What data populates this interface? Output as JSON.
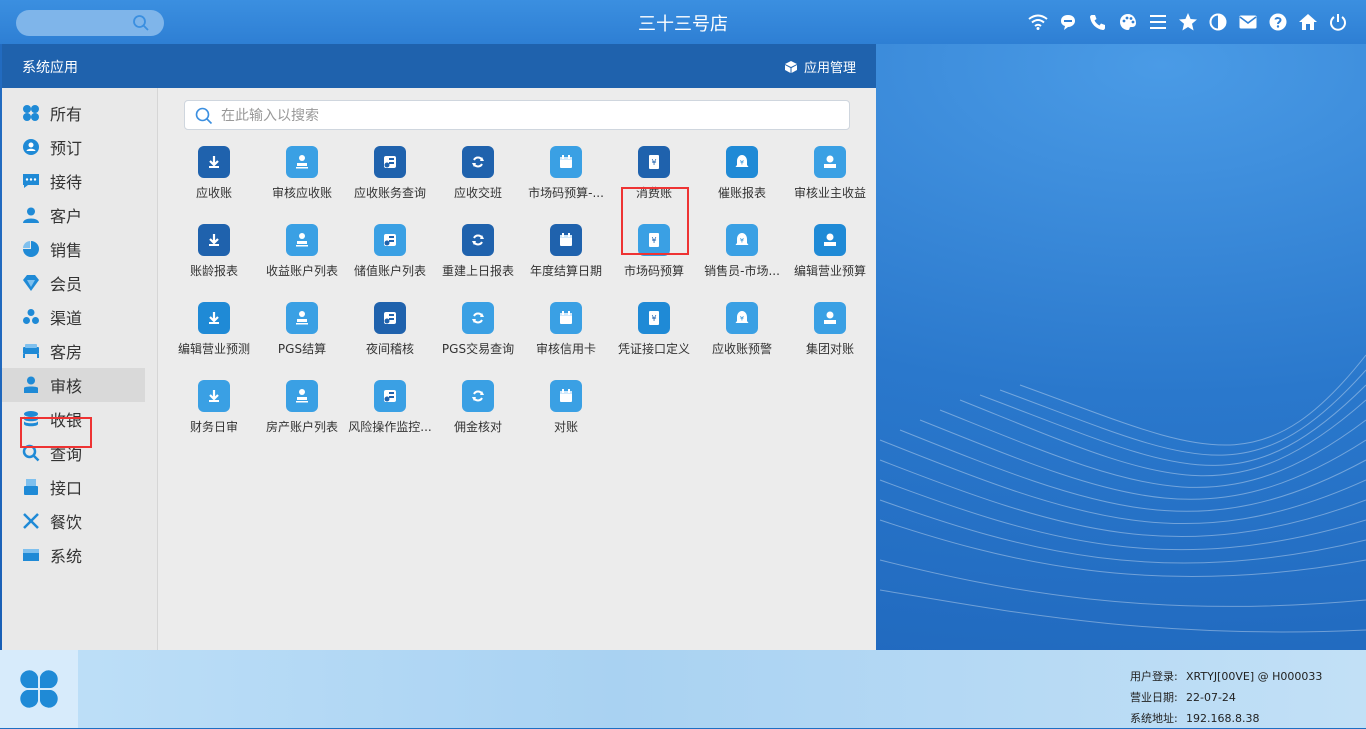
{
  "topbar": {
    "search_placeholder": "",
    "title": "三十三号店",
    "icons": [
      "wifi-icon",
      "chat-icon",
      "phone-icon",
      "palette-icon",
      "menu-icon",
      "star-icon",
      "contrast-icon",
      "mail-icon",
      "help-icon",
      "home-icon",
      "power-icon"
    ]
  },
  "window": {
    "title": "系统应用",
    "app_manage_label": "应用管理",
    "search_placeholder": "在此输入以搜索"
  },
  "sidebar": {
    "items": [
      {
        "label": "所有",
        "icon": "grid-icon"
      },
      {
        "label": "预订",
        "icon": "booking-icon"
      },
      {
        "label": "接待",
        "icon": "reception-icon"
      },
      {
        "label": "客户",
        "icon": "customer-icon"
      },
      {
        "label": "销售",
        "icon": "sales-icon"
      },
      {
        "label": "会员",
        "icon": "member-icon"
      },
      {
        "label": "渠道",
        "icon": "channel-icon"
      },
      {
        "label": "客房",
        "icon": "room-icon"
      },
      {
        "label": "审核",
        "icon": "audit-icon"
      },
      {
        "label": "收银",
        "icon": "cashier-icon"
      },
      {
        "label": "查询",
        "icon": "query-icon"
      },
      {
        "label": "接口",
        "icon": "interface-icon"
      },
      {
        "label": "餐饮",
        "icon": "dining-icon"
      },
      {
        "label": "系统",
        "icon": "system-icon"
      }
    ],
    "active_index": 8
  },
  "apps": [
    {
      "label": "应收账",
      "icon": "receivable-icon",
      "color": "#1f62ad"
    },
    {
      "label": "审核应收账",
      "icon": "audit-receivable-icon",
      "color": "#3aa0e4"
    },
    {
      "label": "应收账务查询",
      "icon": "receivable-query-icon",
      "color": "#1f62ad"
    },
    {
      "label": "应收交班",
      "icon": "shift-handover-icon",
      "color": "#1f62ad"
    },
    {
      "label": "市场码预算-...",
      "icon": "calendar-icon",
      "color": "#3aa0e4"
    },
    {
      "label": "消费账",
      "icon": "consumption-icon",
      "color": "#1f62ad"
    },
    {
      "label": "催账报表",
      "icon": "dunning-icon",
      "color": "#1f8ad6"
    },
    {
      "label": "审核业主收益",
      "icon": "owner-income-icon",
      "color": "#3aa0e4"
    },
    {
      "label": "账龄报表",
      "icon": "aging-report-icon",
      "color": "#1f62ad"
    },
    {
      "label": "收益账户列表",
      "icon": "income-account-icon",
      "color": "#3aa0e4"
    },
    {
      "label": "储值账户列表",
      "icon": "stored-value-icon",
      "color": "#3aa0e4"
    },
    {
      "label": "重建上日报表",
      "icon": "rebuild-report-icon",
      "color": "#1f62ad"
    },
    {
      "label": "年度结算日期",
      "icon": "annual-settle-icon",
      "color": "#1f62ad"
    },
    {
      "label": "市场码预算",
      "icon": "market-budget-icon",
      "color": "#3aa0e4"
    },
    {
      "label": "销售员-市场...",
      "icon": "salesperson-icon",
      "color": "#3aa0e4"
    },
    {
      "label": "编辑营业预算",
      "icon": "edit-budget-icon",
      "color": "#1f8ad6"
    },
    {
      "label": "编辑营业预测",
      "icon": "edit-forecast-icon",
      "color": "#1f8ad6"
    },
    {
      "label": "PGS结算",
      "icon": "pgs-settle-icon",
      "color": "#3aa0e4"
    },
    {
      "label": "夜间稽核",
      "icon": "night-audit-icon",
      "color": "#1f62ad"
    },
    {
      "label": "PGS交易查询",
      "icon": "pgs-query-icon",
      "color": "#3aa0e4"
    },
    {
      "label": "审核信用卡",
      "icon": "credit-card-icon",
      "color": "#3aa0e4"
    },
    {
      "label": "凭证接口定义",
      "icon": "voucher-icon",
      "color": "#1f8ad6"
    },
    {
      "label": "应收账预警",
      "icon": "warning-icon",
      "color": "#3aa0e4"
    },
    {
      "label": "集团对账",
      "icon": "group-reconcile-icon",
      "color": "#3aa0e4"
    },
    {
      "label": "财务日审",
      "icon": "daily-audit-icon",
      "color": "#3aa0e4"
    },
    {
      "label": "房产账户列表",
      "icon": "property-account-icon",
      "color": "#3aa0e4"
    },
    {
      "label": "风险操作监控...",
      "icon": "risk-monitor-icon",
      "color": "#3aa0e4"
    },
    {
      "label": "佣金核对",
      "icon": "commission-icon",
      "color": "#3aa0e4"
    },
    {
      "label": "对账",
      "icon": "reconcile-icon",
      "color": "#3aa0e4"
    }
  ],
  "highlighted_app_index": 5,
  "taskbar": {
    "user_label": "用户登录:",
    "user_value": "XRTYJ[00VE] @ H000033",
    "date_label": "营业日期:",
    "date_value": "22-07-24",
    "addr_label": "系统地址:",
    "addr_value": "192.168.8.38"
  }
}
